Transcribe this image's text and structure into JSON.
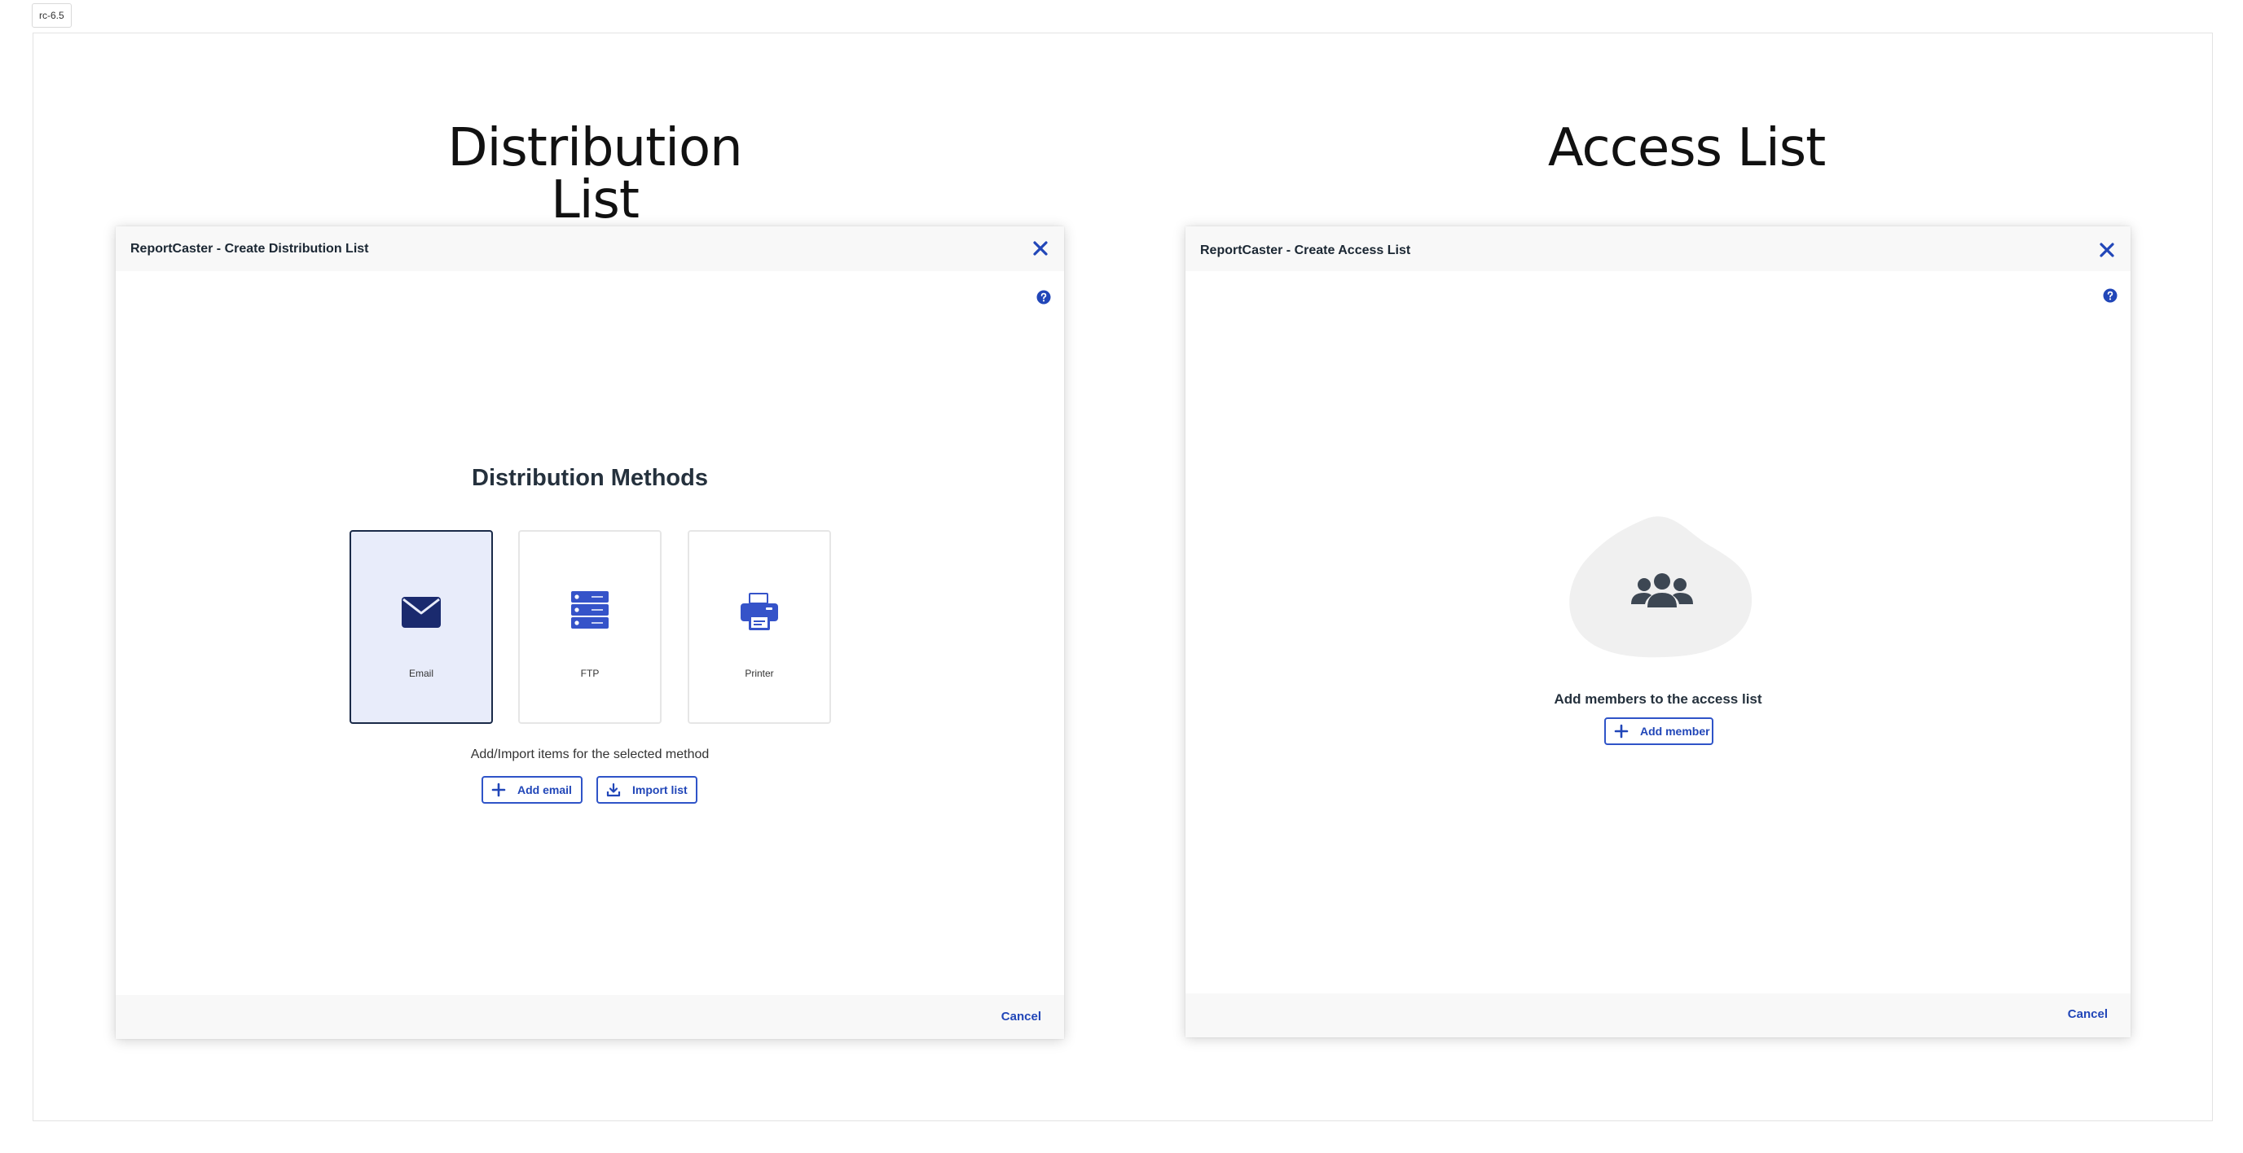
{
  "version_badge": "rc-6.5",
  "headings": {
    "distribution": "Distribution List",
    "access": "Access List"
  },
  "distribution_dialog": {
    "title": "ReportCaster - Create Distribution List",
    "methods_title": "Distribution Methods",
    "methods": [
      {
        "label": "Email",
        "icon": "envelope-icon",
        "selected": true
      },
      {
        "label": "FTP",
        "icon": "server-icon",
        "selected": false
      },
      {
        "label": "Printer",
        "icon": "printer-icon",
        "selected": false
      }
    ],
    "helper_text": "Add/Import items for the selected method",
    "add_button": "Add email",
    "import_button": "Import list",
    "cancel": "Cancel"
  },
  "access_dialog": {
    "title": "ReportCaster - Create Access List",
    "empty_title": "Add members to the access list",
    "add_button": "Add member",
    "cancel": "Cancel"
  },
  "colors": {
    "accent": "#2146b8",
    "icon_dark": "#1a2a6e",
    "icon_blue": "#3553c9",
    "selected_bg": "#e8ecfa",
    "header_bg": "#f8f8f8",
    "blob_bg": "#f0f0f0",
    "users_icon": "#3d4753"
  }
}
